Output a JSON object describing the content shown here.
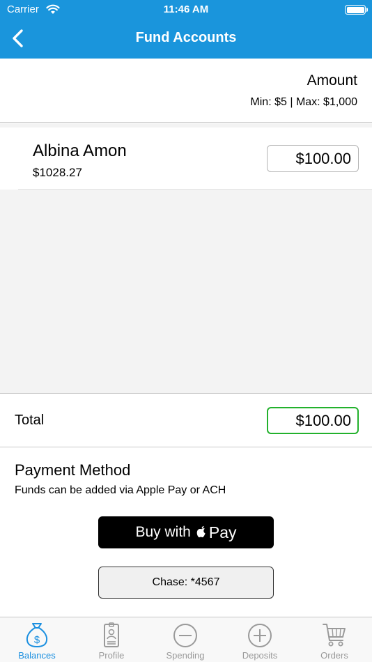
{
  "status_bar": {
    "carrier": "Carrier",
    "time": "11:46 AM"
  },
  "nav": {
    "title": "Fund Accounts",
    "back_icon": "chevron-left-icon"
  },
  "amount_header": {
    "title": "Amount",
    "range": "Min: $5 | Max: $1,000"
  },
  "accounts": [
    {
      "name": "Albina Amon",
      "balance": "$1028.27",
      "amount": "$100.00"
    }
  ],
  "total": {
    "label": "Total",
    "amount": "$100.00"
  },
  "payment": {
    "title": "Payment Method",
    "subtitle": "Funds can be added via Apple Pay or ACH",
    "apple_pay": {
      "prefix": "Buy with",
      "pay": "Pay"
    },
    "ach_button": "Chase: *4567"
  },
  "tabs": [
    {
      "label": "Balances",
      "icon": "money-bag-icon",
      "active": true
    },
    {
      "label": "Profile",
      "icon": "id-badge-icon",
      "active": false
    },
    {
      "label": "Spending",
      "icon": "minus-circle-icon",
      "active": false
    },
    {
      "label": "Deposits",
      "icon": "plus-circle-icon",
      "active": false
    },
    {
      "label": "Orders",
      "icon": "cart-icon",
      "active": false
    }
  ],
  "colors": {
    "header": "#1a95dc",
    "active_tab": "#1a8fe0",
    "inactive_tab": "#9a9a9a",
    "total_border": "#22b12c",
    "background_gray": "#f3f3f3"
  }
}
